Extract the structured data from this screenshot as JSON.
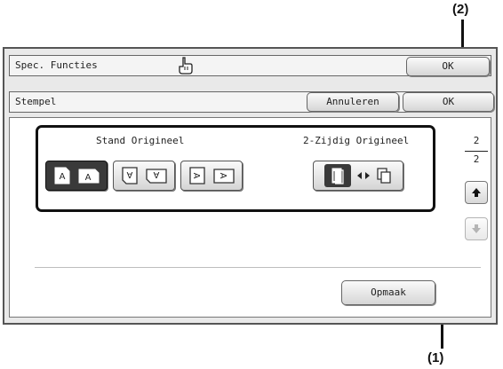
{
  "callouts": {
    "top": "(2)",
    "bottom": "(1)"
  },
  "window": {
    "title": "Spec. Functies",
    "ok_label": "OK"
  },
  "subbar": {
    "title": "Stempel",
    "cancel_label": "Annuleren",
    "ok_label": "OK"
  },
  "orientation": {
    "heading": "Stand Origineel",
    "options": [
      "upright",
      "rotated",
      "sideways"
    ],
    "selected_index": 0
  },
  "duplex": {
    "heading": "2-Zijdig Origineel"
  },
  "pager": {
    "current": "2",
    "total": "2"
  },
  "footer": {
    "layout_label": "Opmaak"
  },
  "icons": {
    "title_icon": "hand-pointer-icon",
    "up": "arrow-up-icon",
    "down": "arrow-down-icon"
  }
}
